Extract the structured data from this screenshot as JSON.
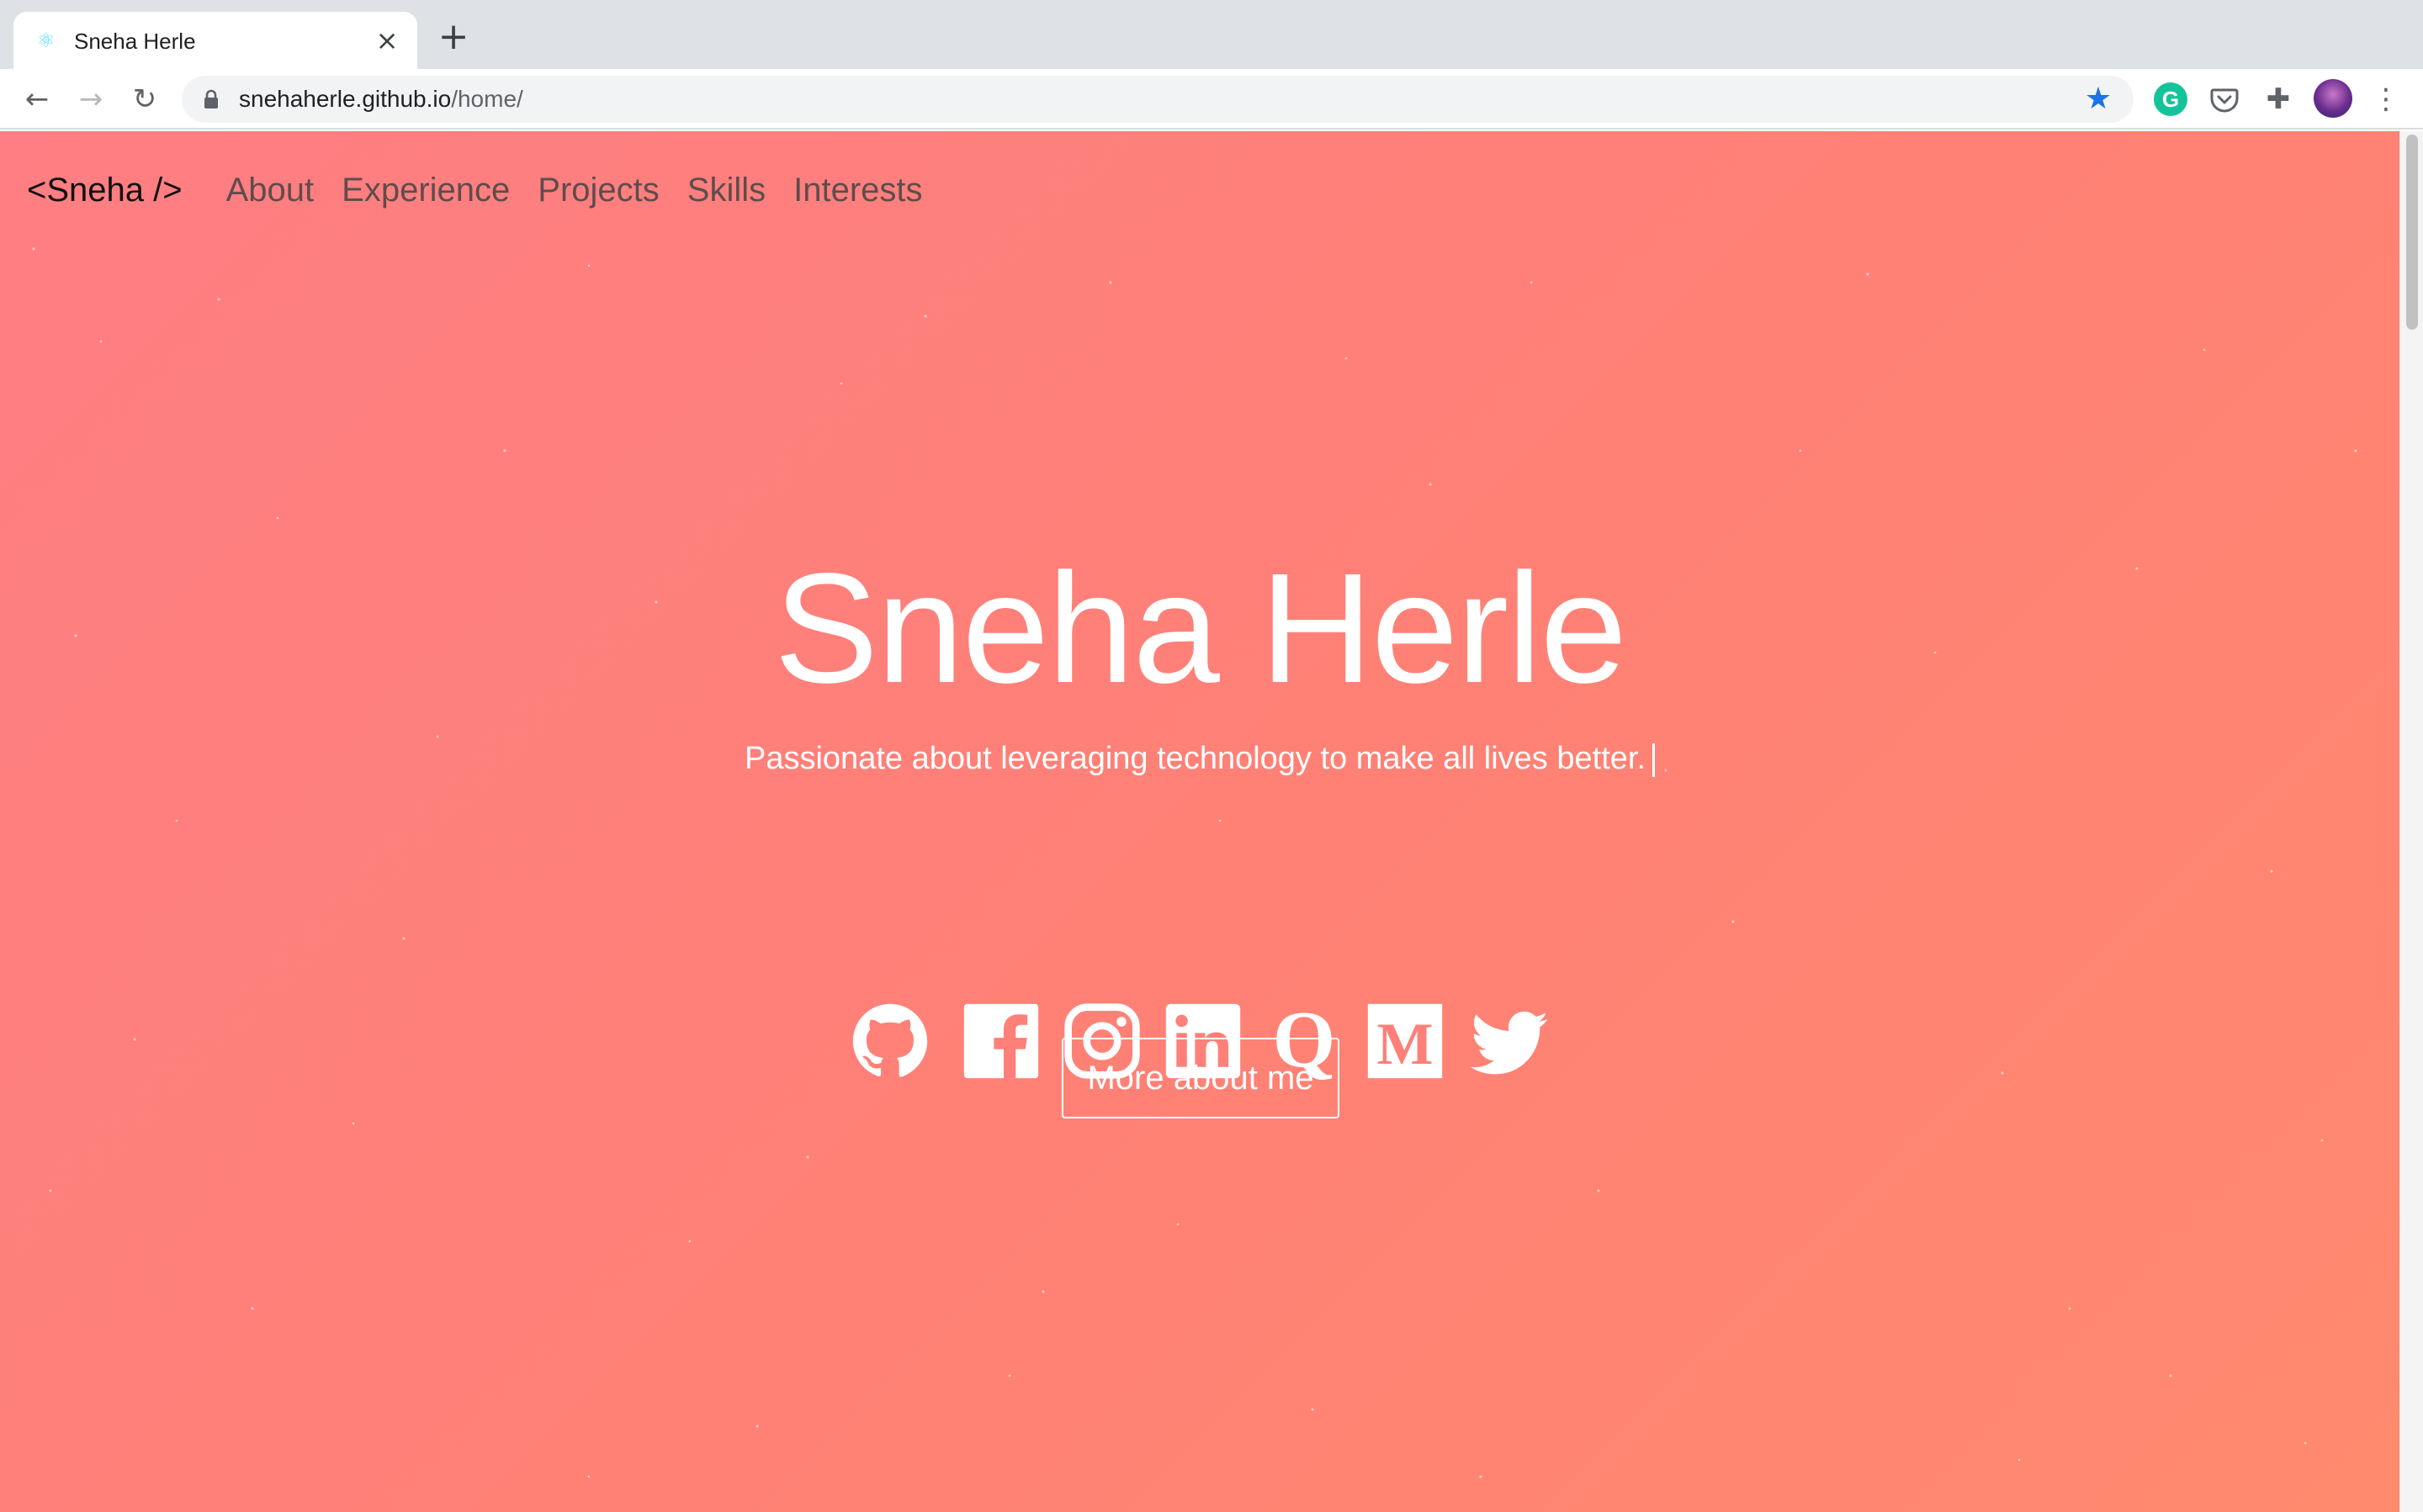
{
  "browser": {
    "tab_title": "Sneha Herle",
    "tab_close_icon": "×",
    "new_tab_icon": "+",
    "url_host": "snehaherle.github.io",
    "url_path": "/home/",
    "back_icon": "←",
    "forward_icon": "→",
    "reload_icon": "↻",
    "bookmark_icon": "★",
    "grammarly_label": "G",
    "extensions_icon": "✚",
    "menu_icon": "⋮"
  },
  "site": {
    "brand": "<Sneha />",
    "nav": [
      {
        "label": "About"
      },
      {
        "label": "Experience"
      },
      {
        "label": "Projects"
      },
      {
        "label": "Skills"
      },
      {
        "label": "Interests"
      }
    ],
    "hero_name": "Sneha Herle",
    "tagline": "Passionate about leveraging technology to make all lives better.",
    "socials": [
      "github-icon",
      "facebook-icon",
      "instagram-icon",
      "linkedin-icon",
      "quora-icon",
      "medium-icon",
      "twitter-icon"
    ],
    "medium_letter": "M",
    "quora_letter": "Q",
    "cta_label": "More about me"
  },
  "colors": {
    "gradient_start": "#fe7e83",
    "gradient_end": "#ff8a6e",
    "bookmark_star": "#1a73e8",
    "grammarly": "#15c39a",
    "white": "#ffffff"
  }
}
